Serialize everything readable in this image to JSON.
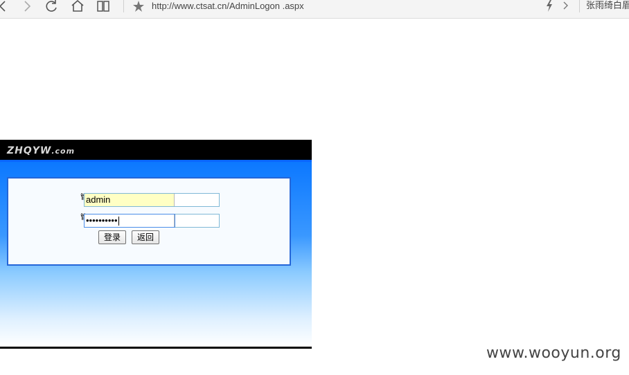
{
  "browser": {
    "url": "http://www.ctsat.cn/AdminLogon .aspx",
    "user": "张雨绮白眉",
    "icons": [
      "back-icon",
      "forward-icon",
      "reload-icon",
      "home-icon",
      "reading-mode-icon",
      "star-icon",
      "lightning-icon",
      "chevron-right-icon"
    ]
  },
  "login": {
    "brand": "ZHQYW",
    "brand_suffix": ".com",
    "username_label": "管",
    "username_value": "admin",
    "password_label": "管",
    "password_value": "••••••••••",
    "login_button": "登录",
    "back_button": "返回"
  },
  "watermark": "www.wooyun.org",
  "colors": {
    "brand_bar": "#000000",
    "gradient_top": "#0c78ff",
    "panel_border": "#2566d8",
    "username_fill": "#ffffc4"
  }
}
